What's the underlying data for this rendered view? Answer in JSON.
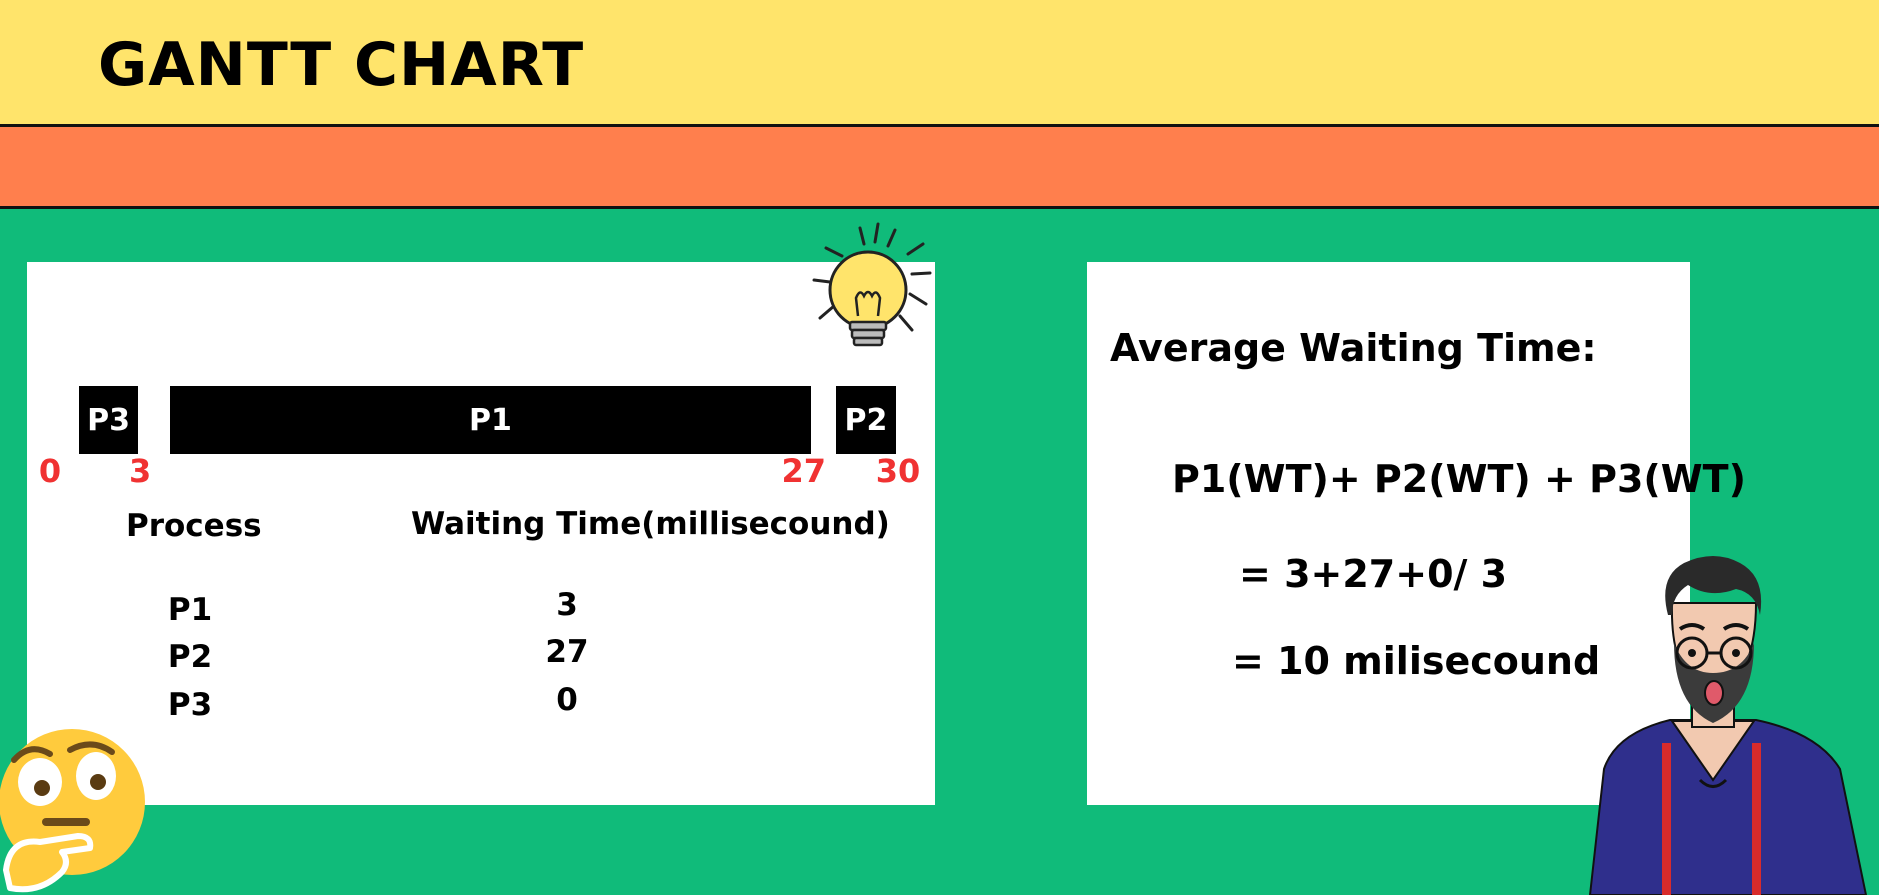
{
  "header": {
    "title": "GANTT CHART"
  },
  "chart_data": {
    "type": "gantt",
    "unit": "millisecound",
    "segments": [
      {
        "label": "P3",
        "start": 0,
        "end": 3
      },
      {
        "label": "P1",
        "start": 3,
        "end": 27
      },
      {
        "label": "P2",
        "start": 27,
        "end": 30
      }
    ],
    "ticks": [
      "0",
      "3",
      "27",
      "30"
    ],
    "xlim": [
      0,
      30
    ]
  },
  "table": {
    "headers": [
      "Process",
      "Waiting Time(millisecound)"
    ],
    "rows": [
      {
        "process": "P1",
        "wt": "3"
      },
      {
        "process": "P2",
        "wt": "27"
      },
      {
        "process": "P3",
        "wt": "0"
      }
    ]
  },
  "calculation": {
    "heading": "Average Waiting Time:",
    "formula": "P1(WT)+ P2(WT) + P3(WT)",
    "step1": "=  3+27+0/ 3",
    "result": "= 10 milisecound"
  },
  "colors": {
    "background": "#10bb7a",
    "header_band": "#ffe46b",
    "accent_band": "#ff7f4d",
    "tick_labels": "#f03232",
    "bars": "#000000"
  },
  "icons": [
    "lightbulb-icon",
    "thinking-face-icon",
    "surprised-man-illustration"
  ]
}
